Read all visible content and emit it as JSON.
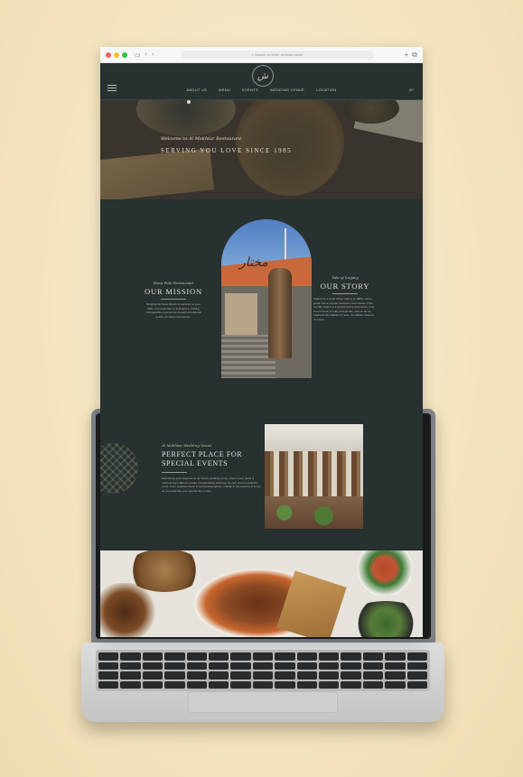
{
  "browser": {
    "url_placeholder": "Search or enter website name",
    "dots": [
      "#fe5f57",
      "#febc2e",
      "#28c840"
    ]
  },
  "nav": {
    "logo_text": "ش",
    "links": [
      "ABOUT US",
      "MENU",
      "EVENTS",
      "WEDDING VENUE",
      "LOCATION"
    ],
    "lang": "AR"
  },
  "hero": {
    "script": "Welcome to Al Mokhtar Restaurant",
    "title": "SERVING YOU LOVE SINCE 1985"
  },
  "mission": {
    "subtitle": "Bona Fide Restaurant",
    "title": "OUR MISSION",
    "body": "Bringing the finest flavors of Lebanon to your table, our restaurant is dedicated to crafting unforgettable experiences through exceptional quality of cuisine and service."
  },
  "story": {
    "subtitle": "Tale of Legacy",
    "title": "OUR STORY",
    "body": "Started as a small village bakery in 1985s, we've grown into a popular restaurant and market. From humble origins to a special dining experience, now it's our home to many friends like. Join us as we celebrate the tradition of taste, the hidden treasure of a time."
  },
  "events": {
    "subtitle": "Al Mokhtar Wedding Venue",
    "title_line1": "PERFECT PLACE FOR",
    "title_line2": "SPECIAL EVENTS",
    "body": "Experience your elegance at our luxury wedding venue, where every detail is meticulously crafted to create a breathtaking backdrop for your once-in-a-lifetime event. From exquisite decor to sensational service, indulge in the epitome of luxury as you celebrate your special day in style."
  },
  "colors": {
    "page_bg": "#263130",
    "accent_text": "#e9e3d2",
    "backdrop": "#f4e6c4"
  }
}
